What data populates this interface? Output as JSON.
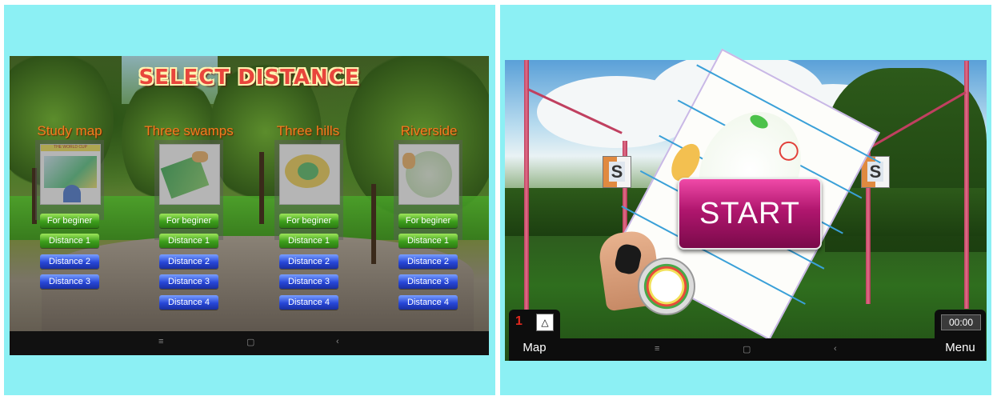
{
  "left": {
    "title": "SELECT DISTANCE",
    "columns": [
      {
        "title": "Study map",
        "buttons": [
          {
            "label": "For beginer",
            "color": "green"
          },
          {
            "label": "Distance 1",
            "color": "green"
          },
          {
            "label": "Distance 2",
            "color": "blue"
          },
          {
            "label": "Distance 3",
            "color": "blue"
          }
        ]
      },
      {
        "title": "Three swamps",
        "buttons": [
          {
            "label": "For beginer",
            "color": "green"
          },
          {
            "label": "Distance 1",
            "color": "green"
          },
          {
            "label": "Distance 2",
            "color": "blue"
          },
          {
            "label": "Distance 3",
            "color": "blue"
          },
          {
            "label": "Distance 4",
            "color": "blue"
          }
        ]
      },
      {
        "title": "Three hills",
        "buttons": [
          {
            "label": "For beginer",
            "color": "green"
          },
          {
            "label": "Distance 1",
            "color": "green"
          },
          {
            "label": "Distance 2",
            "color": "blue"
          },
          {
            "label": "Distance 3",
            "color": "blue"
          },
          {
            "label": "Distance 4",
            "color": "blue"
          }
        ]
      },
      {
        "title": "Riverside",
        "buttons": [
          {
            "label": "For beginer",
            "color": "green"
          },
          {
            "label": "Distance 1",
            "color": "green"
          },
          {
            "label": "Distance 2",
            "color": "blue"
          },
          {
            "label": "Distance 3",
            "color": "blue"
          },
          {
            "label": "Distance 4",
            "color": "blue"
          }
        ]
      }
    ],
    "study_map_header": "THE WORLD CUP",
    "nav": {
      "menu_icon": "≡",
      "home_icon": "▢",
      "back_icon": "‹"
    }
  },
  "right": {
    "start_label": "START",
    "flag_letter": "S",
    "map_hud": {
      "number": "1",
      "mini_icon": "compass-needle-icon",
      "label": "Map"
    },
    "menu_hud": {
      "timer": "00:00",
      "label": "Menu"
    },
    "nav": {
      "menu_icon": "≡",
      "home_icon": "▢",
      "back_icon": "‹"
    }
  },
  "colors": {
    "background_panel": "#8cf0f4",
    "start_button": "#b0166e",
    "title_red": "#e8453c",
    "column_title_orange": "#f47b20"
  }
}
